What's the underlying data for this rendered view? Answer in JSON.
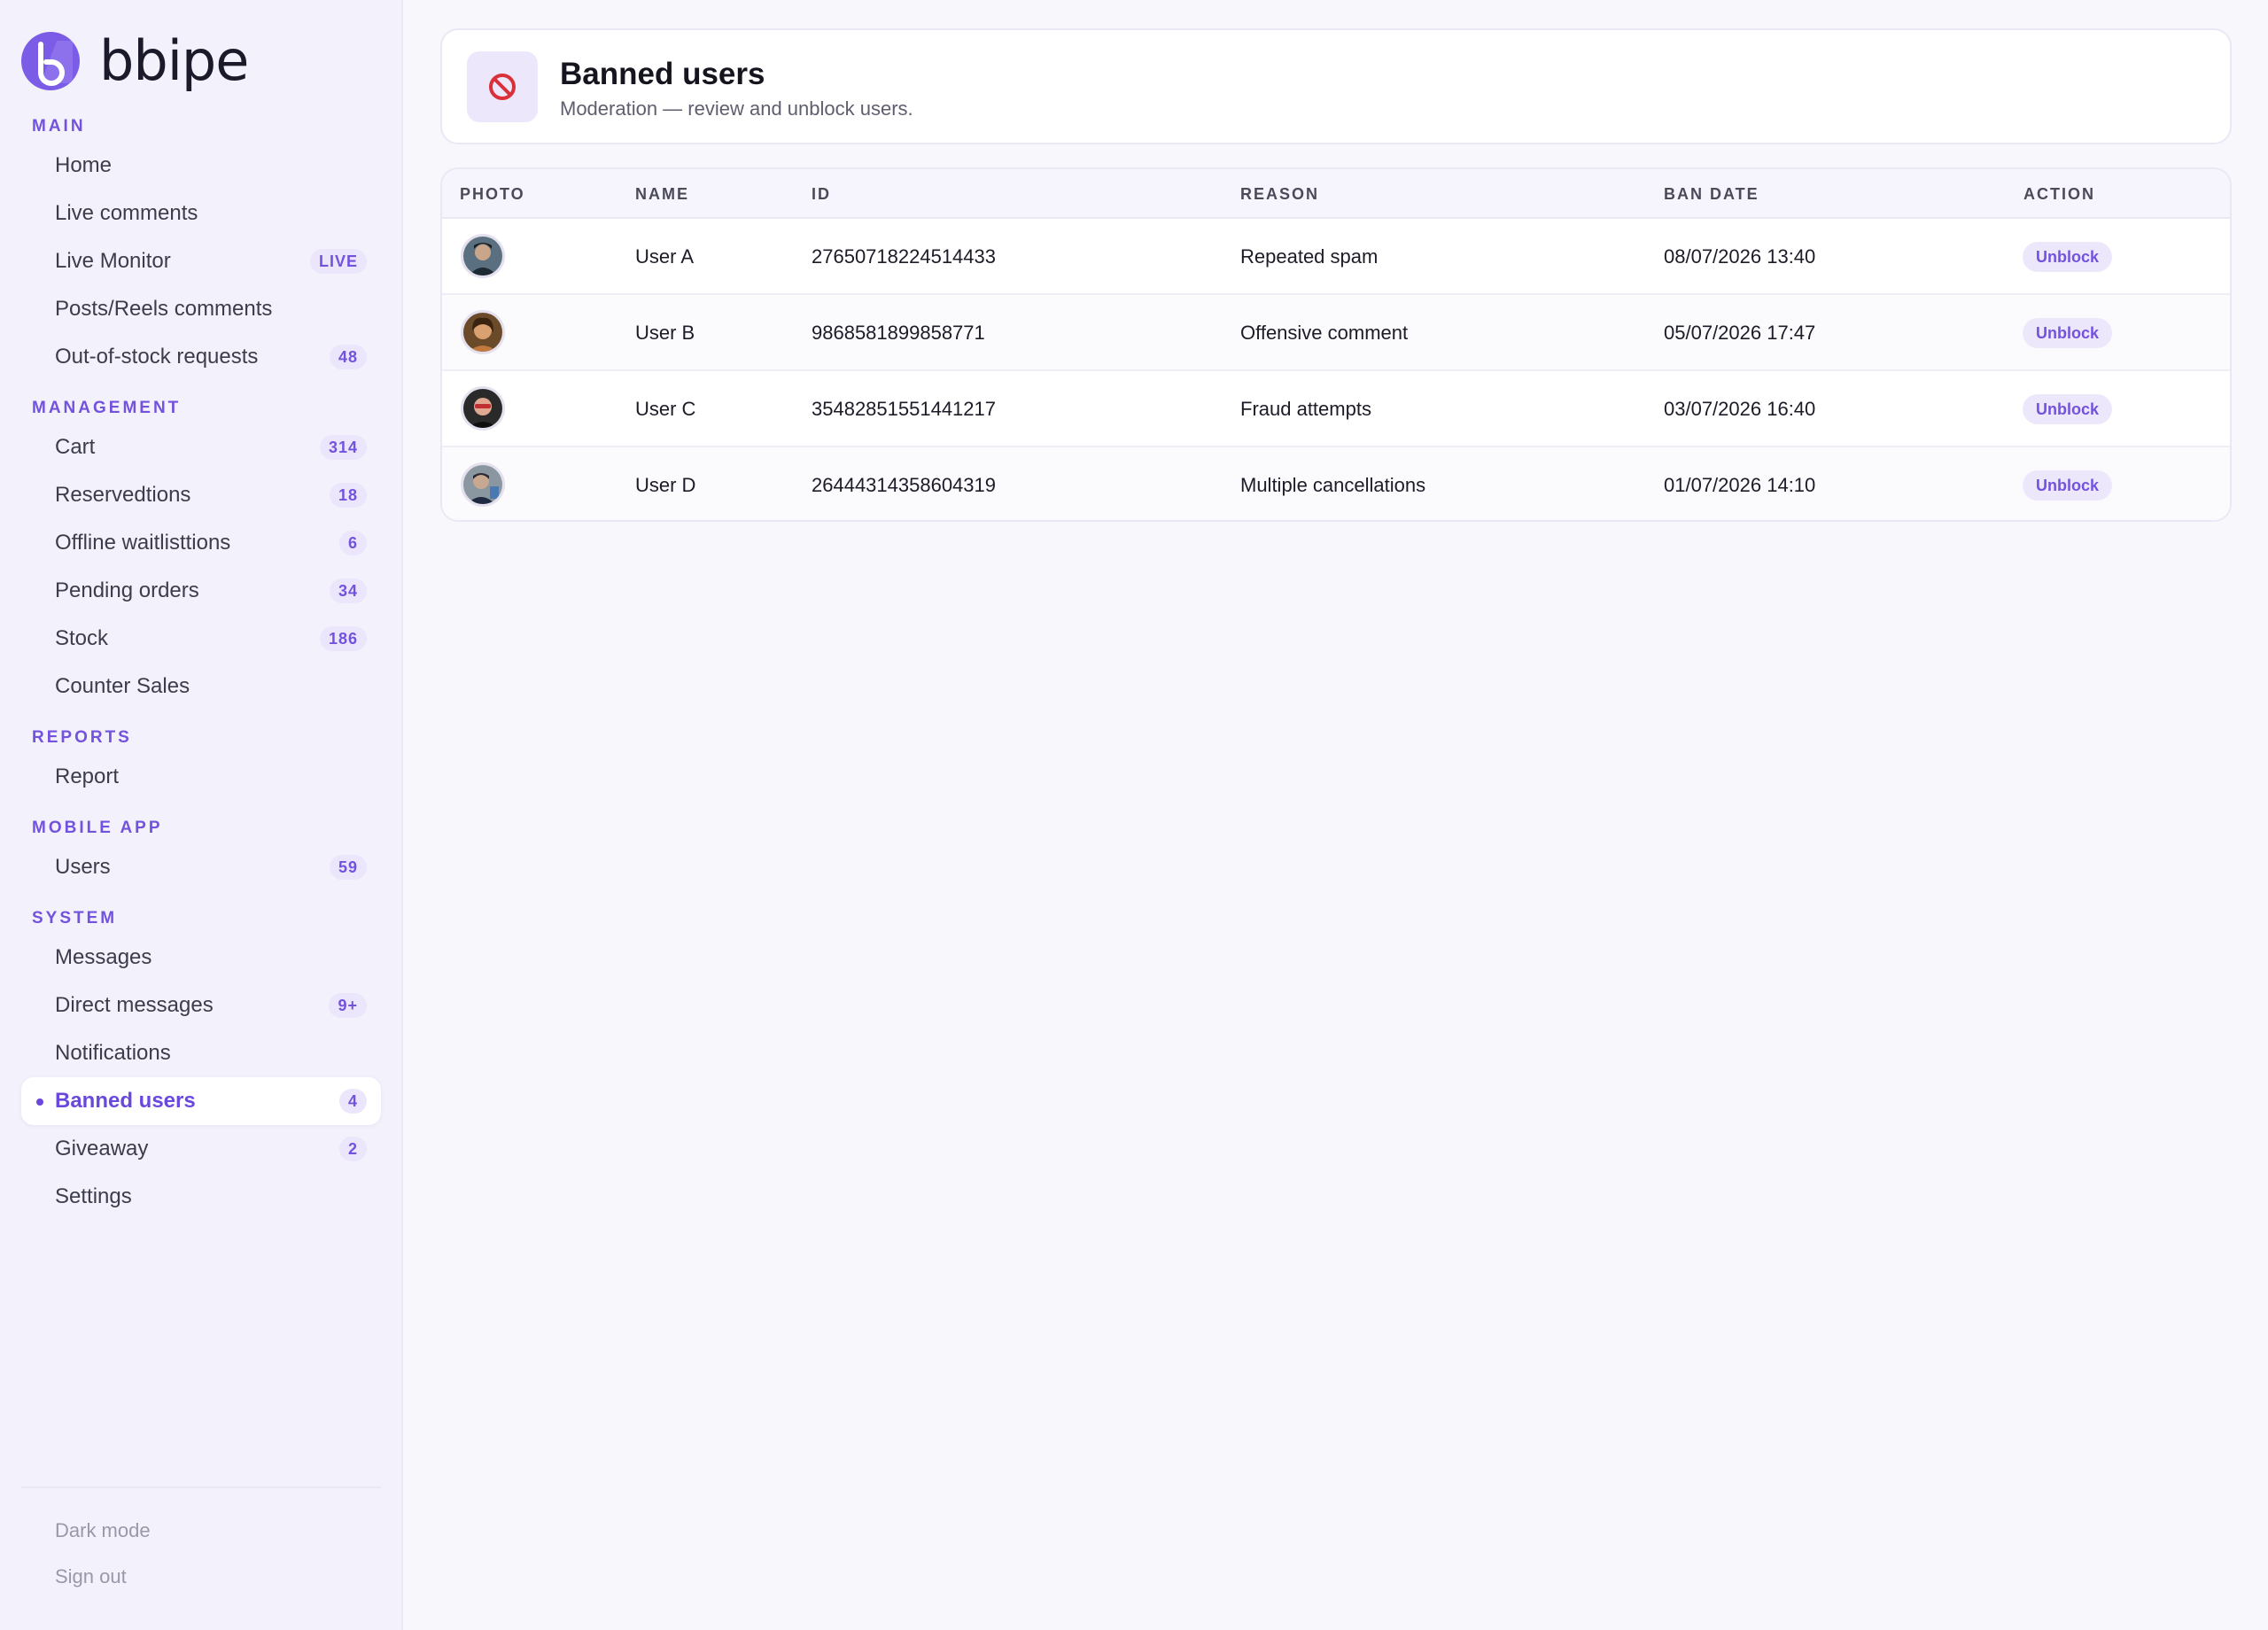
{
  "brand": {
    "name": "bbipe"
  },
  "sidebar": {
    "sections": [
      {
        "label": "MAIN",
        "items": [
          {
            "label": "Home",
            "badge": ""
          },
          {
            "label": "Live comments",
            "badge": ""
          },
          {
            "label": "Live Monitor",
            "badge": "LIVE"
          },
          {
            "label": "Posts/Reels comments",
            "badge": ""
          },
          {
            "label": "Out-of-stock requests",
            "badge": "48"
          }
        ]
      },
      {
        "label": "MANAGEMENT",
        "items": [
          {
            "label": "Cart",
            "badge": "314"
          },
          {
            "label": "Reservedtions",
            "badge": "18"
          },
          {
            "label": "Offline waitlisttions",
            "badge": "6"
          },
          {
            "label": "Pending orders",
            "badge": "34"
          },
          {
            "label": "Stock",
            "badge": "186"
          },
          {
            "label": "Counter Sales",
            "badge": ""
          }
        ]
      },
      {
        "label": "REPORTS",
        "items": [
          {
            "label": "Report",
            "badge": ""
          }
        ]
      },
      {
        "label": "MOBILE APP",
        "items": [
          {
            "label": "Users",
            "badge": "59"
          }
        ]
      },
      {
        "label": "SYSTEM",
        "items": [
          {
            "label": "Messages",
            "badge": ""
          },
          {
            "label": "Direct messages",
            "badge": "9+"
          },
          {
            "label": "Notifications",
            "badge": ""
          },
          {
            "label": "Banned users",
            "badge": "4",
            "active": true
          },
          {
            "label": "Giveaway",
            "badge": "2"
          },
          {
            "label": "Settings",
            "badge": ""
          }
        ]
      }
    ],
    "footer": {
      "dark_mode": "Dark mode",
      "sign_out": "Sign out"
    }
  },
  "header": {
    "icon": "no-entry-icon",
    "title": "Banned users",
    "subtitle": "Moderation — review and unblock users."
  },
  "table": {
    "columns": [
      "PHOTO",
      "NAME",
      "ID",
      "REASON",
      "BAN DATE",
      "ACTION"
    ],
    "rows": [
      {
        "name": "User A",
        "id": "27650718224514433",
        "reason": "Repeated spam",
        "ban_date": "08/07/2026 13:40",
        "action": "Unblock"
      },
      {
        "name": "User B",
        "id": "9868581899858771",
        "reason": "Offensive comment",
        "ban_date": "05/07/2026 17:47",
        "action": "Unblock"
      },
      {
        "name": "User C",
        "id": "35482851551441217",
        "reason": "Fraud attempts",
        "ban_date": "03/07/2026 16:40",
        "action": "Unblock"
      },
      {
        "name": "User D",
        "id": "26444314358604319",
        "reason": "Multiple cancellations",
        "ban_date": "01/07/2026 14:10",
        "action": "Unblock"
      }
    ]
  },
  "colors": {
    "accent": "#7352dd",
    "background": "#f7f7fc",
    "sidebar": "#f3f1fb",
    "danger": "#d9303a"
  }
}
